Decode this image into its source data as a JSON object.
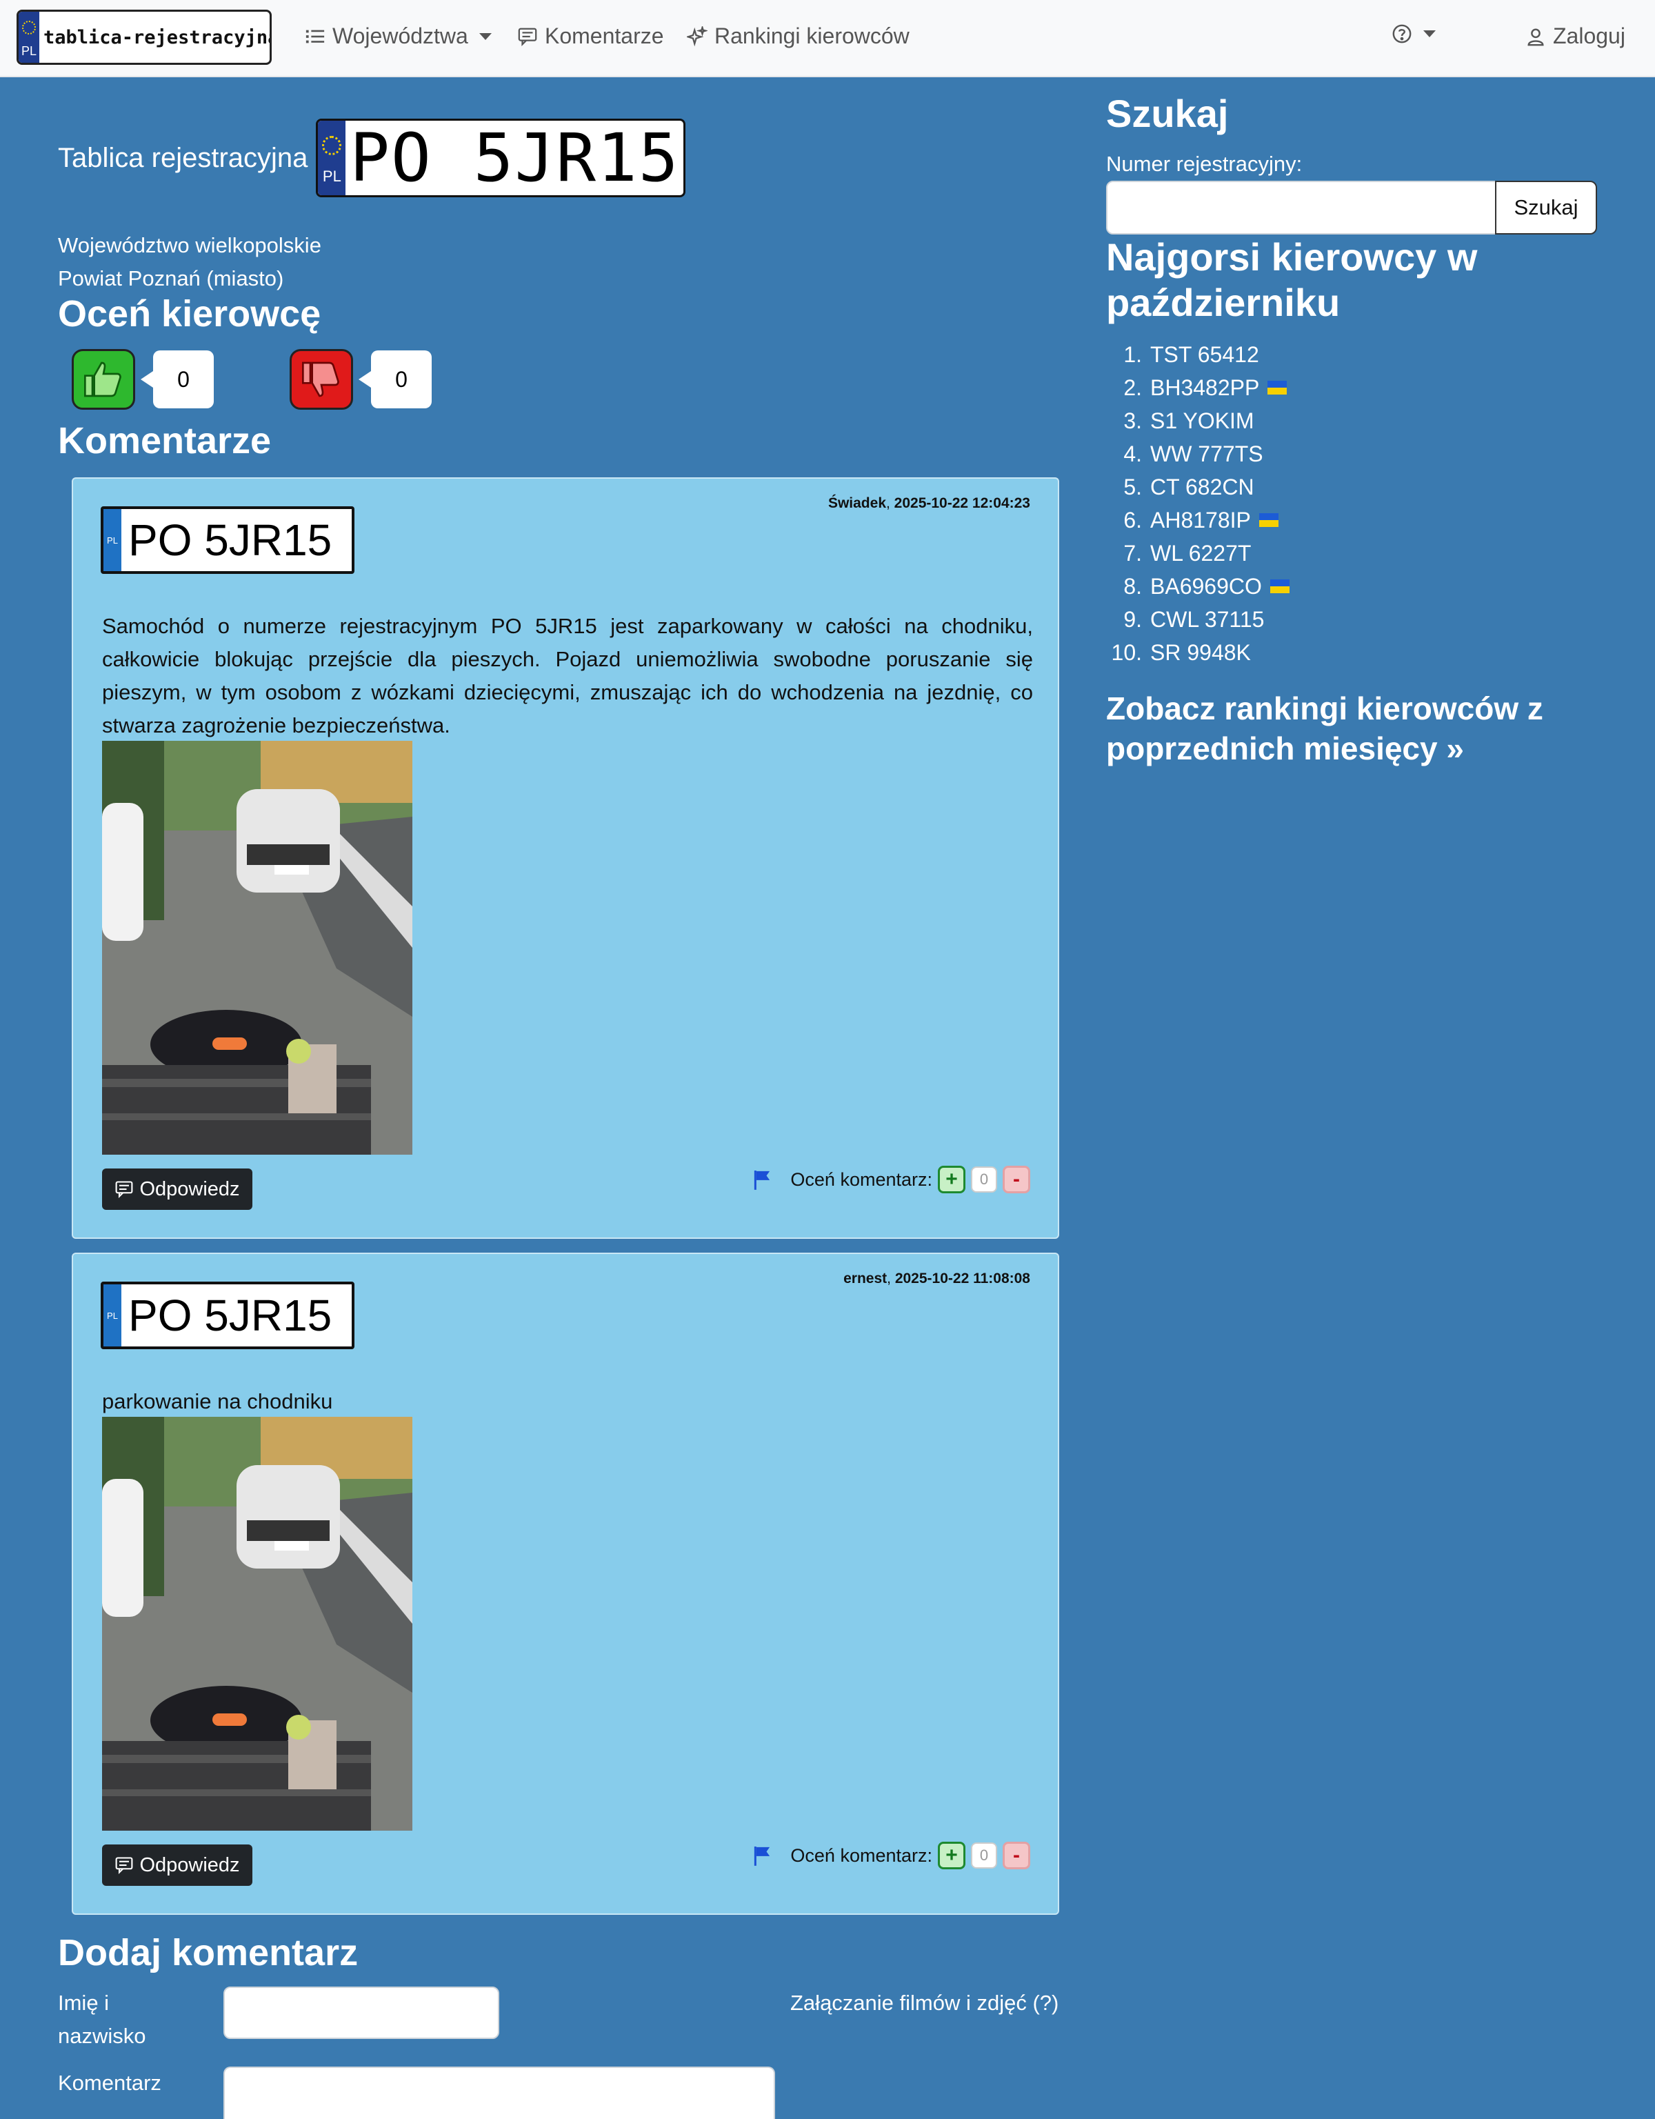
{
  "brand": {
    "text": "tablica-rejestracyjna.pl",
    "country": "PL"
  },
  "nav": {
    "wojewodztwa": "Województwa",
    "komentarze": "Komentarze",
    "rankingi": "Rankingi kierowców",
    "zaloguj": "Zaloguj"
  },
  "plate": {
    "label": "Tablica rejestracyjna",
    "number": "PO 5JR15",
    "country": "PL",
    "voivodeship": "Województwo wielkopolskie",
    "county": "Powiat Poznań (miasto)"
  },
  "rate_driver": {
    "heading": "Oceń kierowcę",
    "thumbs_up": "0",
    "thumbs_down": "0"
  },
  "comments_heading": "Komentarze",
  "comments": [
    {
      "author": "Świadek",
      "date": "2025-10-22 12:04:23",
      "plate": "PO 5JR15",
      "text": "Samochód o numerze rejestracyjnym PO 5JR15 jest zaparkowany w całości na chodniku, całkowicie blokując przejście dla pieszych. Pojazd uniemożliwia swobodne poruszanie się pieszym, w tym osobom z wózkami dziecięcymi, zmuszając ich do wchodzenia na jezdnię, co stwarza zagrożenie bezpieczeństwa.",
      "reply_label": "Odpowiedz",
      "rate_label": "Oceń komentarz:",
      "score": "0",
      "plus": "+",
      "minus": "-"
    },
    {
      "author": "ernest",
      "date": "2025-10-22 11:08:08",
      "plate": "PO 5JR15",
      "text": "parkowanie na chodniku",
      "reply_label": "Odpowiedz",
      "rate_label": "Oceń komentarz:",
      "score": "0",
      "plus": "+",
      "minus": "-"
    }
  ],
  "add_comment": {
    "heading": "Dodaj komentarz",
    "name_label_1": "Imię i",
    "name_label_2": "nazwisko",
    "comment_label": "Komentarz",
    "attach_label": "Załączanie filmów i zdjęć (?)"
  },
  "sidebar": {
    "search_heading": "Szukaj",
    "search_label": "Numer rejestracyjny:",
    "search_button": "Szukaj",
    "ranking_heading_1": "Najgorsi kierowcy w",
    "ranking_heading_2": "październiku",
    "ranking": [
      {
        "n": "1.",
        "plate": "TST 65412",
        "ua": false
      },
      {
        "n": "2.",
        "plate": "BH3482PP",
        "ua": true
      },
      {
        "n": "3.",
        "plate": "S1 YOKIM",
        "ua": false
      },
      {
        "n": "4.",
        "plate": "WW 777TS",
        "ua": false
      },
      {
        "n": "5.",
        "plate": "CT 682CN",
        "ua": false
      },
      {
        "n": "6.",
        "plate": "AH8178IP",
        "ua": true
      },
      {
        "n": "7.",
        "plate": "WL 6227T",
        "ua": false
      },
      {
        "n": "8.",
        "plate": "BA6969CO",
        "ua": true
      },
      {
        "n": "9.",
        "plate": "CWL 37115",
        "ua": false
      },
      {
        "n": "10.",
        "plate": "SR 9948K",
        "ua": false
      }
    ],
    "history_link_1": "Zobacz rankingi kierowców z",
    "history_link_2": "poprzednich miesięcy »"
  },
  "colors": {
    "page_bg": "#3a7ab0",
    "card_bg": "#87cceb",
    "navbar_bg": "#f8f9fa",
    "thumb_up": "#2eb82e",
    "thumb_down": "#e01a1a"
  }
}
